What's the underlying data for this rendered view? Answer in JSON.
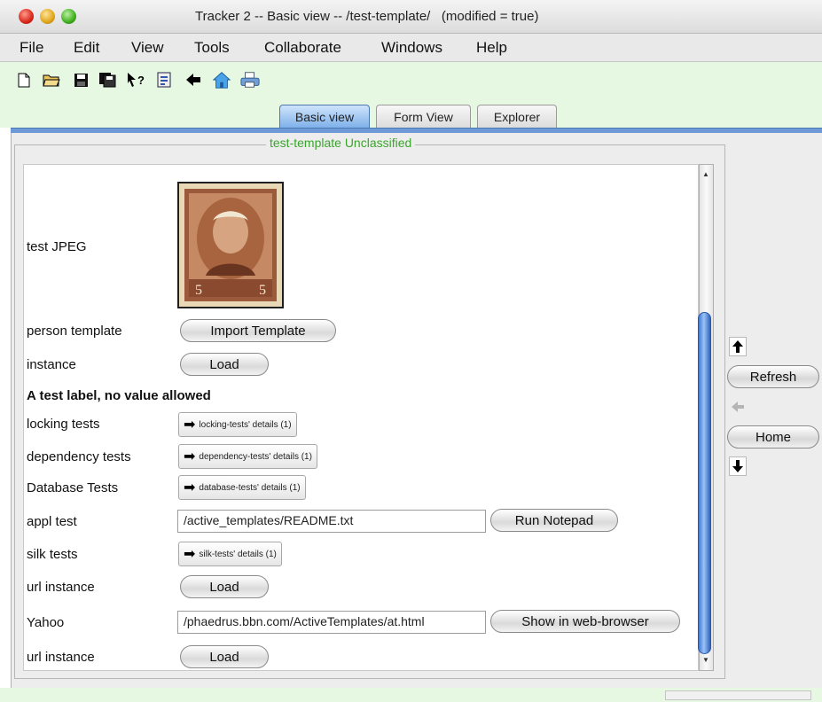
{
  "window": {
    "title": "Tracker 2 -- Basic view -- /test-template/   (modified = true)"
  },
  "menu": [
    "File",
    "Edit",
    "View",
    "Tools",
    "Collaborate",
    "Windows",
    "Help"
  ],
  "toolbar_icons": [
    "new-file-icon",
    "open-folder-icon",
    "save-icon",
    "save-all-icon",
    "help-cursor-icon",
    "document-icon",
    "back-arrow-icon",
    "home-icon",
    "print-icon"
  ],
  "tabs": [
    {
      "label": "Basic view",
      "active": true
    },
    {
      "label": "Form View",
      "active": false
    },
    {
      "label": "Explorer",
      "active": false
    }
  ],
  "panel": {
    "title": "test-template Unclassified"
  },
  "rows": {
    "test_jpeg": {
      "label": "test JPEG"
    },
    "person_template": {
      "label": "person template",
      "button": "Import Template"
    },
    "instance": {
      "label": "instance",
      "button": "Load"
    },
    "test_label": {
      "label": "A test label, no value allowed"
    },
    "locking_tests": {
      "label": "locking tests",
      "button": "locking-tests' details (1)"
    },
    "dependency_tests": {
      "label": "dependency tests",
      "button": "dependency-tests' details (1)"
    },
    "database_tests": {
      "label": "Database Tests",
      "button": "database-tests' details (1)"
    },
    "appl_test": {
      "label": "appl test",
      "value": "/active_templates/README.txt",
      "button": "Run Notepad"
    },
    "silk_tests": {
      "label": "silk tests",
      "button": "silk-tests' details (1)"
    },
    "url_instance_1": {
      "label": "url instance",
      "button": "Load"
    },
    "yahoo": {
      "label": "Yahoo",
      "value": "/phaedrus.bbn.com/ActiveTemplates/at.html",
      "button": "Show in web-browser"
    },
    "url_instance_2": {
      "label": "url instance",
      "button": "Load"
    }
  },
  "nav": {
    "refresh": "Refresh",
    "home": "Home"
  },
  "colors": {
    "panel_title": "#3aa52c",
    "toolbar_bg": "#e6f8e2",
    "tab_active": "#7fb1ea",
    "scroll_thumb": "#3f78d6"
  }
}
